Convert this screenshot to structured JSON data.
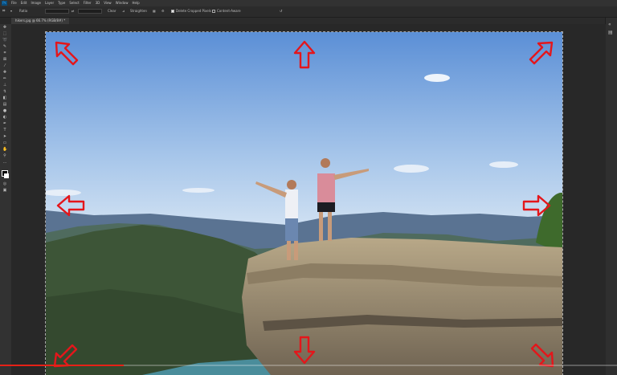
{
  "menubar": {
    "items": [
      "File",
      "Edit",
      "Image",
      "Layer",
      "Type",
      "Select",
      "Filter",
      "3D",
      "View",
      "Window",
      "Help"
    ]
  },
  "options": {
    "ratio_label": "Ratio",
    "clear_label": "Clear",
    "straighten_label": "Straighten",
    "delete_cropped_label": "Delete Cropped Pixels",
    "content_aware_label": "Content-Aware"
  },
  "document": {
    "tab_label": "hikers.jpg @ 66.7% (RGB/8#) *"
  },
  "video": {
    "progress": 0.2
  },
  "colors": {
    "accent": "#31a8ff",
    "arrow": "#e4161b",
    "progress": "#e62117"
  },
  "crop_arrows": {
    "directions": [
      "up-left",
      "up",
      "up-right",
      "left",
      "right",
      "down-left",
      "down",
      "down-right"
    ]
  }
}
